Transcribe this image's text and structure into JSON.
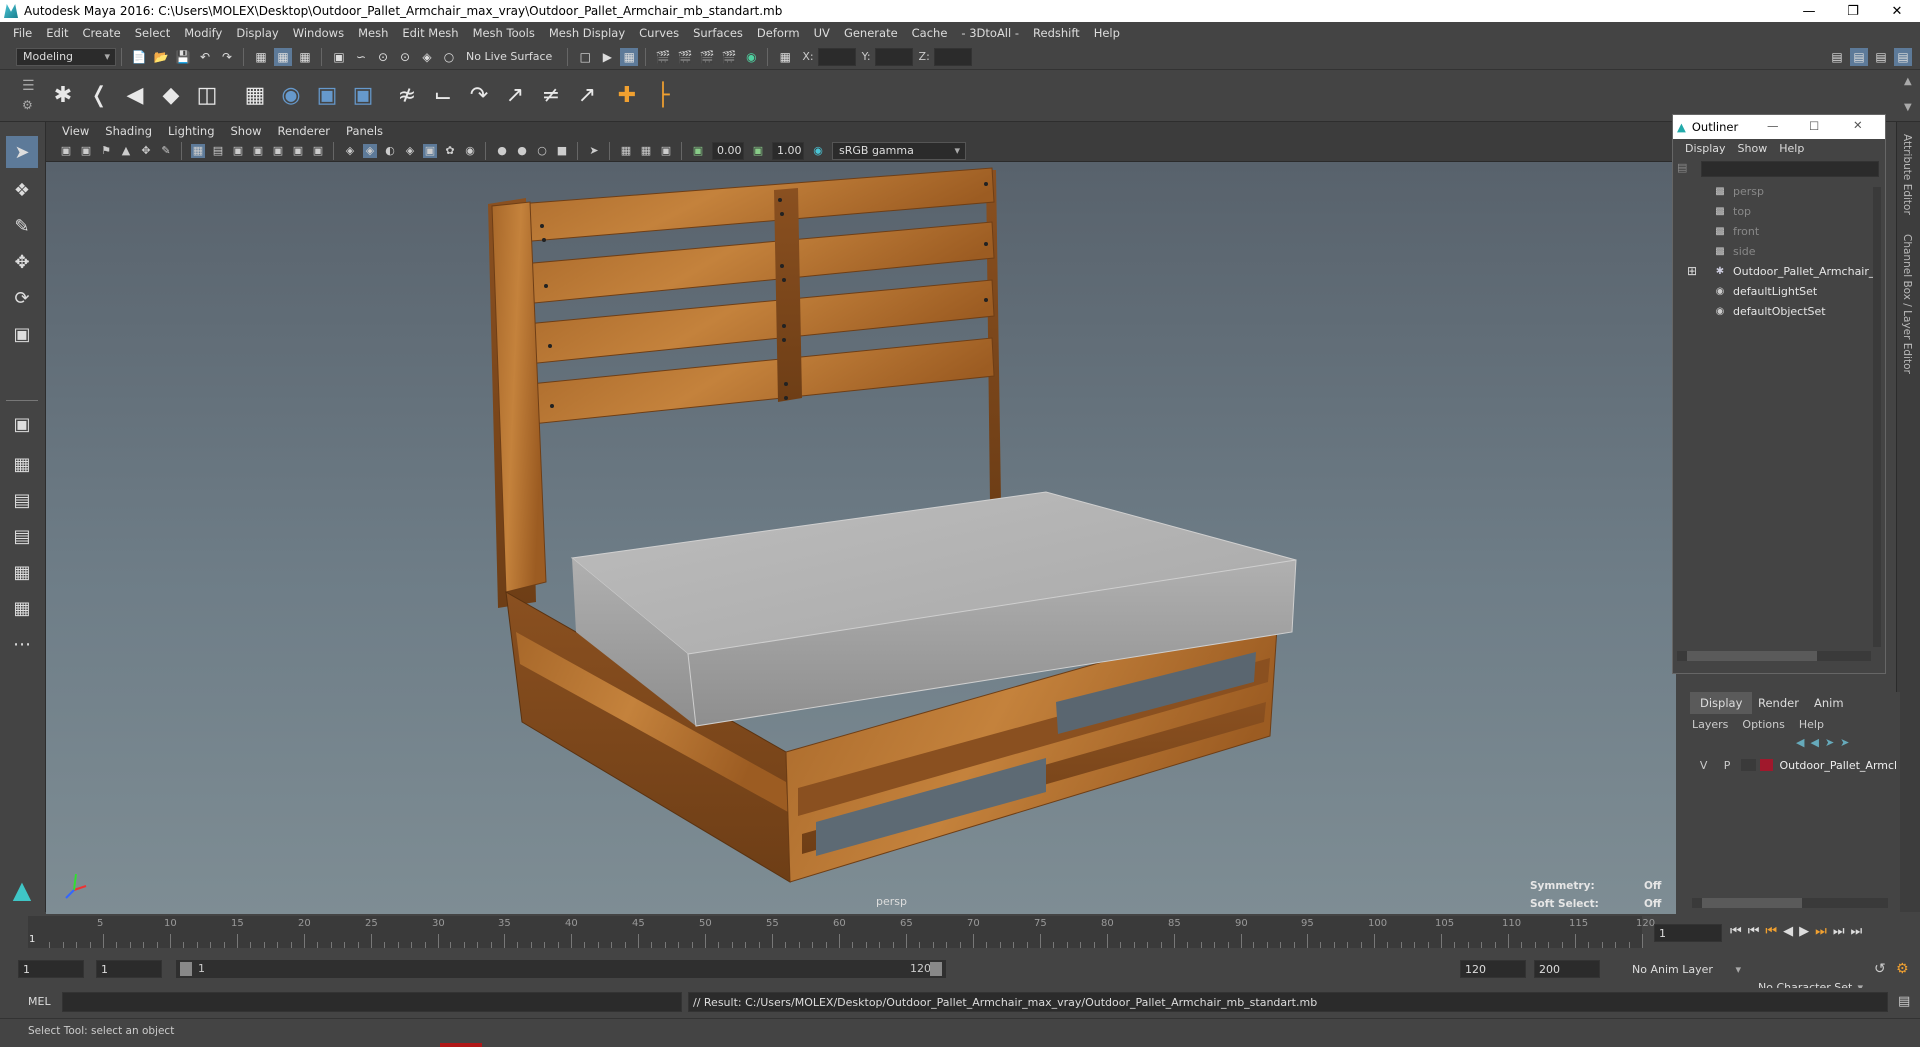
{
  "window": {
    "title": "Autodesk Maya 2016: C:\\Users\\MOLEX\\Desktop\\Outdoor_Pallet_Armchair_max_vray\\Outdoor_Pallet_Armchair_mb_standart.mb"
  },
  "menubar": [
    "File",
    "Edit",
    "Create",
    "Select",
    "Modify",
    "Display",
    "Windows",
    "Mesh",
    "Edit Mesh",
    "Mesh Tools",
    "Mesh Display",
    "Curves",
    "Surfaces",
    "Deform",
    "UV",
    "Generate",
    "Cache",
    "- 3DtoAll -",
    "Redshift",
    "Help"
  ],
  "statusline": {
    "mode": "Modeling",
    "live_surface": "No Live Surface",
    "x_label": "X:",
    "y_label": "Y:",
    "z_label": "Z:"
  },
  "viewport": {
    "menu": [
      "View",
      "Shading",
      "Lighting",
      "Show",
      "Renderer",
      "Panels"
    ],
    "near_value": "0.00",
    "far_value": "1.00",
    "color_space": "sRGB gamma",
    "camera": "persp",
    "symmetry_label": "Symmetry:",
    "symmetry_value": "Off",
    "soft_select_label": "Soft Select:",
    "soft_select_value": "Off"
  },
  "outliner": {
    "title": "Outliner",
    "menu": [
      "Display",
      "Show",
      "Help"
    ],
    "items": [
      {
        "label": "persp",
        "icon": "camera-icon",
        "dim": true
      },
      {
        "label": "top",
        "icon": "camera-icon",
        "dim": true
      },
      {
        "label": "front",
        "icon": "camera-icon",
        "dim": true
      },
      {
        "label": "side",
        "icon": "camera-icon",
        "dim": true
      },
      {
        "label": "Outdoor_Pallet_Armchair_",
        "icon": "group-icon",
        "dim": false
      },
      {
        "label": "defaultLightSet",
        "icon": "set-icon",
        "dim": false
      },
      {
        "label": "defaultObjectSet",
        "icon": "set-icon",
        "dim": false
      }
    ]
  },
  "side_tabs": [
    "Attribute Editor",
    "Channel Box / Layer Editor"
  ],
  "layers": {
    "tabs": [
      "Display",
      "Render",
      "Anim"
    ],
    "menu": [
      "Layers",
      "Options",
      "Help"
    ],
    "row": {
      "v": "V",
      "p": "P",
      "name": "Outdoor_Pallet_Armch",
      "color": "#a0182c"
    }
  },
  "timeline": {
    "ticks": [
      "5",
      "10",
      "15",
      "20",
      "25",
      "30",
      "35",
      "40",
      "45",
      "50",
      "55",
      "60",
      "65",
      "70",
      "75",
      "80",
      "85",
      "90",
      "95",
      "100",
      "105",
      "110",
      "115",
      "120"
    ],
    "start_marker": "1",
    "current_frame": "1"
  },
  "range": {
    "start": "1",
    "playback_start": "1",
    "slider_start": "1",
    "slider_end": "120",
    "playback_end": "120",
    "end": "200",
    "anim_layer": "No Anim Layer",
    "char_set": "No Character Set"
  },
  "command": {
    "label": "MEL",
    "result": "// Result: C:/Users/MOLEX/Desktop/Outdoor_Pallet_Armchair_max_vray/Outdoor_Pallet_Armchair_mb_standart.mb"
  },
  "help_line": "Select Tool: select an object"
}
